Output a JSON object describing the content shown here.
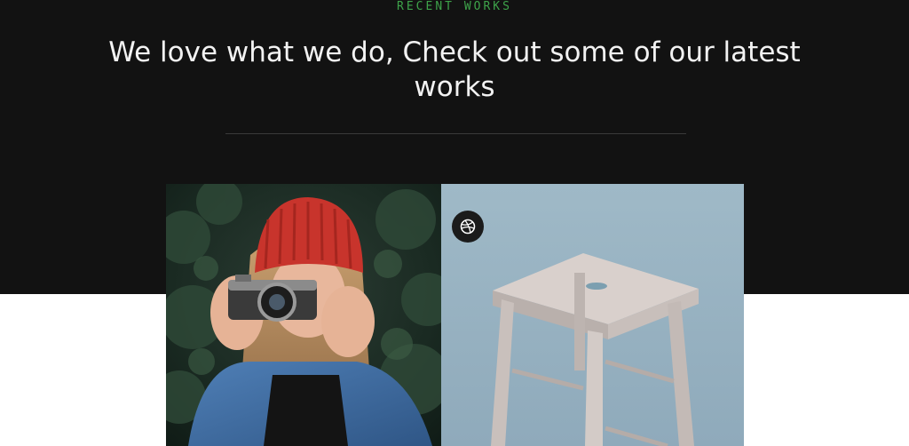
{
  "section": {
    "eyebrow": "RECENT WORKS",
    "headline": "We love what we do, Check out some of our latest works"
  },
  "works": [
    {
      "subject": "photographer-with-camera"
    },
    {
      "subject": "wooden-stool"
    }
  ],
  "icons": {
    "badge": "dribbble-icon"
  },
  "colors": {
    "background_dark": "#121212",
    "accent_green": "#3ea34a",
    "headline_text": "#f2f2f2",
    "panel_blue": "#9fb9c7"
  }
}
